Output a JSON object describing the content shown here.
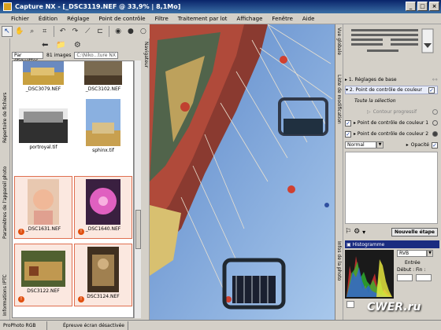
{
  "window": {
    "title": "Capture NX - [_DSC3119.NEF @ 33,9% | 8,1Mo]",
    "min": "_",
    "max": "□",
    "close": "×"
  },
  "menu": [
    "Fichier",
    "Édition",
    "Réglage",
    "Point de contrôle",
    "Filtre",
    "Traitement par lot",
    "Affichage",
    "Fenêtre",
    "Aide"
  ],
  "browser": {
    "group_by": "Par étiquettes",
    "count": "81 images",
    "path": "C:\\Niko...ture NX",
    "thumbs": [
      {
        "name": "_DSC3079.NEF",
        "badge": ""
      },
      {
        "name": "_DSC3102.NEF",
        "badge": ""
      },
      {
        "name": "portroyal.tif",
        "badge": ""
      },
      {
        "name": "sphinx.tif",
        "badge": ""
      },
      {
        "name": "_DSC1631.NEF",
        "badge": "!"
      },
      {
        "name": "_DSC1640.NEF",
        "badge": "!"
      },
      {
        "name": "DSC3122.NEF",
        "badge": "!"
      },
      {
        "name": "DSC3124.NEF",
        "badge": "!"
      }
    ]
  },
  "left_tabs": [
    "Répertoire de fichiers",
    "Paramètres de l'appareil photo",
    "Informations IPTC"
  ],
  "nav_tab": "Navigateur",
  "right_tabs": [
    "Vue globale",
    "Liste de modification",
    "Infos de la photo"
  ],
  "edit_list": {
    "step1": "1. Réglages de base",
    "step2": "2. Point de contrôle de couleur",
    "selection": "Toute la sélection",
    "contour": "Contour progressif",
    "cp1": "Point de contrôle de couleur 1",
    "cp2": "Point de contrôle de couleur 2",
    "blend_mode": "Normal",
    "opacity_label": "Opacité",
    "new_step": "Nouvelle étape"
  },
  "histogram": {
    "title": "Histogramme",
    "channel": "RVB",
    "entry_label": "Entrée",
    "start_label": "Début :",
    "end_label": "Fin :"
  },
  "status": {
    "profile": "ProPhoto RGB",
    "proof": "Épreuve écran désactivée"
  },
  "watermark": "CWER.ru"
}
